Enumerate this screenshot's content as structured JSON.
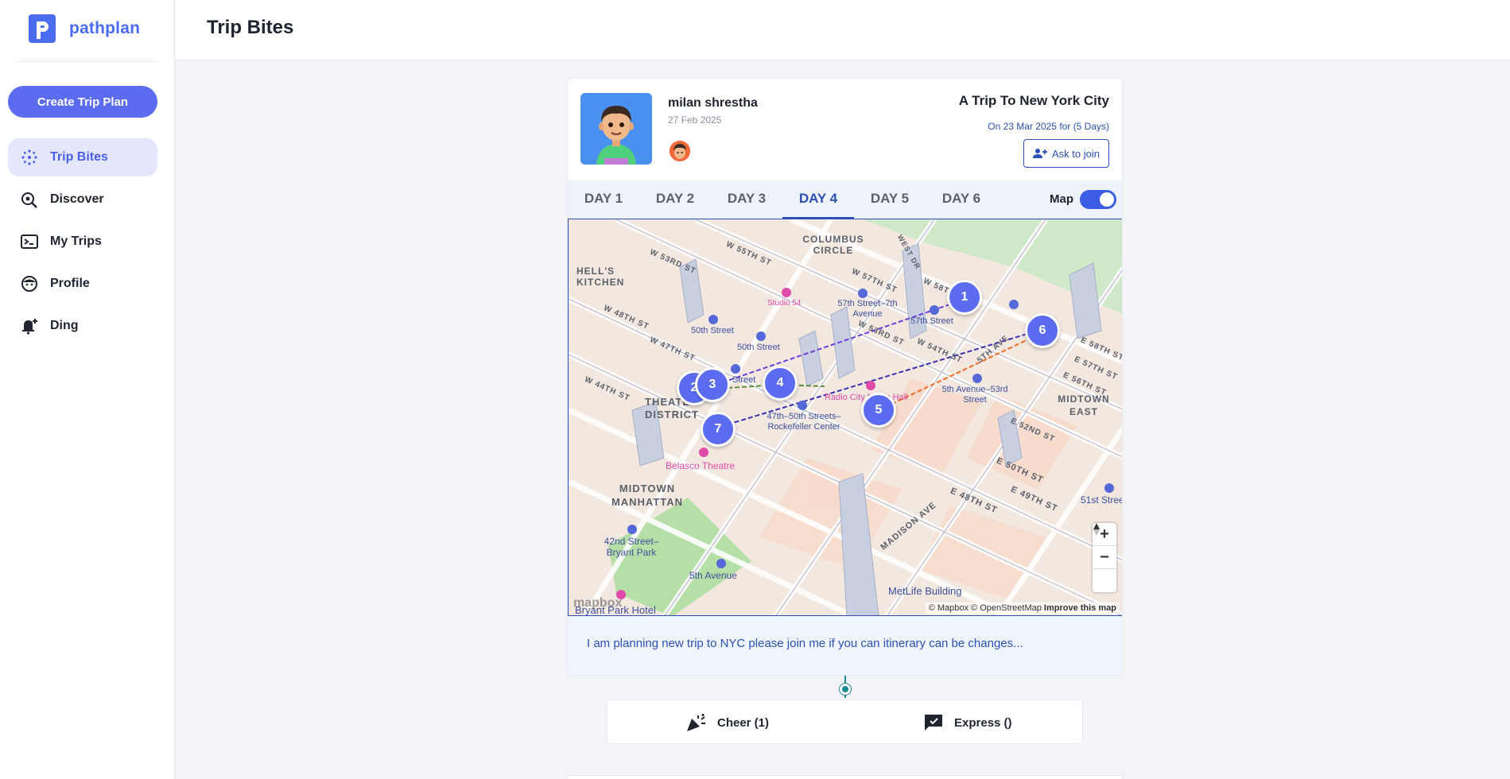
{
  "app": {
    "name": "pathplan"
  },
  "sidebar": {
    "create_button": "Create Trip Plan",
    "items": [
      {
        "label": "Trip Bites",
        "icon": "sparkle-icon",
        "active": true
      },
      {
        "label": "Discover",
        "icon": "discover-icon",
        "active": false
      },
      {
        "label": "My Trips",
        "icon": "trips-icon",
        "active": false
      },
      {
        "label": "Profile",
        "icon": "profile-icon",
        "active": false
      },
      {
        "label": "Ding",
        "icon": "bell-icon",
        "active": false
      }
    ]
  },
  "header": {
    "title": "Trip Bites"
  },
  "post": {
    "user_name": "milan shrestha",
    "date": "27 Feb 2025",
    "trip_title": "A Trip To New York City",
    "trip_subtitle": "On 23 Mar 2025 for (5 Days)",
    "join_button": "Ask to join",
    "tabs": [
      "DAY 1",
      "DAY 2",
      "DAY 3",
      "DAY 4",
      "DAY 5",
      "DAY 6"
    ],
    "active_tab": "DAY 4",
    "map_toggle_label": "Map",
    "map_toggle_on": true,
    "description": "I am planning new trip to NYC please join me if you can itinerary can be changes..."
  },
  "map": {
    "neighborhoods": [
      "HELL'S KITCHEN",
      "COLUMBUS CIRCLE",
      "THEATER DISTRICT",
      "MIDTOWN MANHATTAN",
      "MIDTOWN EAST"
    ],
    "streets": [
      "W 53RD ST",
      "W 55TH ST",
      "W 48TH ST",
      "W 47TH ST",
      "W 44TH ST",
      "W 57TH ST",
      "W 58TH ST",
      "W 53RD ST",
      "W 54TH ST",
      "5TH AVE",
      "E 58TH ST",
      "E 57TH ST",
      "E 56TH ST",
      "E 52ND ST",
      "E 50TH ST",
      "E 49TH ST",
      "E 48TH ST",
      "MADISON AVE",
      "WEST DR"
    ],
    "stations": [
      "50th Street",
      "50th Street",
      "57th Street–7th Avenue",
      "57th Street",
      "5th Avenue–53rd Street",
      "47th–50th Streets–Rockefeller Center",
      "42nd Street–Bryant Park",
      "5th Avenue",
      "51st Street",
      "Street"
    ],
    "pois": [
      "Studio 54",
      "Radio City Music Hall",
      "Belasco Theatre",
      "MetLife Building",
      "Bryant Park Hotel"
    ],
    "pins": [
      "1",
      "2",
      "3",
      "4",
      "5",
      "6",
      "7"
    ],
    "attribution": "© Mapbox © OpenStreetMap",
    "improve_link": "Improve this map",
    "logo_text": "mapbox",
    "zoom_in": "+",
    "zoom_out": "−"
  },
  "reactions": {
    "cheer": "Cheer (1)",
    "express": "Express ()"
  },
  "colors": {
    "brand": "#4a6cf2",
    "accent_button": "#5b6cf0",
    "link": "#2c4fb8",
    "teal_connector": "#1b8a8f"
  }
}
